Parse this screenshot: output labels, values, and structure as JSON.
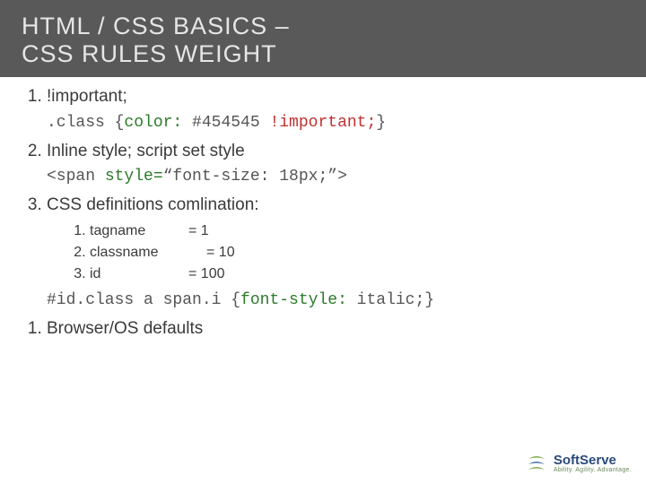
{
  "header": {
    "title_prefix": "HTML / CSS",
    "title_word1": "BASICS",
    "title_dash": "–",
    "title_line2a": "CSS",
    "title_line2b": "RULES WEIGHT"
  },
  "items": {
    "i1": {
      "num": "1.",
      "text": "!important;"
    },
    "code1": {
      "pre": ".class {",
      "prop": "color:",
      "val": " #454545 ",
      "imp": "!important;",
      "post": "}"
    },
    "i2": {
      "num": "2.",
      "text": "Inline style; script set style"
    },
    "code2": {
      "pre": "<span ",
      "attr": "style=",
      "val": "“font-size: 18px;”",
      "post": ">"
    },
    "i3": {
      "num": "3.",
      "text": "CSS definitions comlination:"
    },
    "sub": {
      "s1": {
        "label": "tagname",
        "eq": "= 1"
      },
      "s2": {
        "label": "classname",
        "eq": "= 10"
      },
      "s3": {
        "label": "id",
        "eq": "= 100"
      }
    },
    "code3": {
      "pre": "#id.class a span.i {",
      "prop": "font-style:",
      "val": " italic;",
      "post": "}"
    },
    "i4": {
      "num": "1.",
      "text": "Browser/OS defaults"
    }
  },
  "logo": {
    "name": "SoftServe",
    "tagline": "Ability. Agility. Advantage."
  }
}
